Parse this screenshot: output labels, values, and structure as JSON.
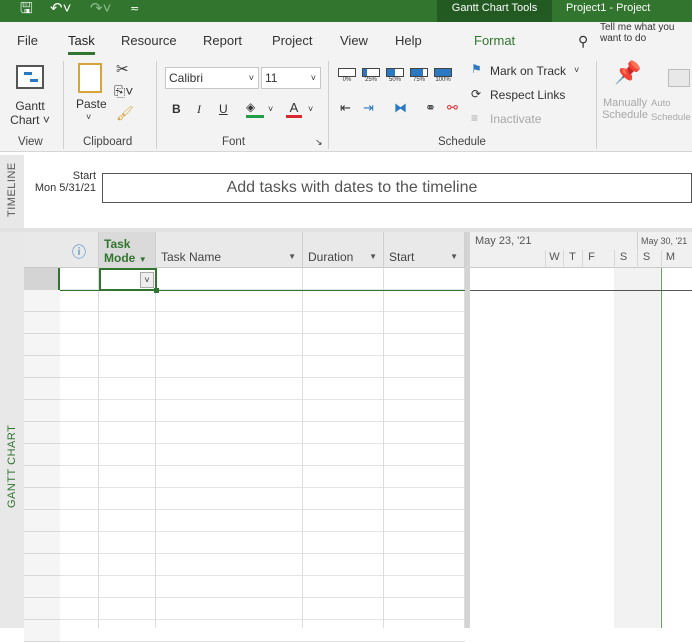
{
  "titlebar": {
    "context_tab": "Gantt Chart Tools",
    "title": "Project1  -  Project"
  },
  "tabs": [
    "File",
    "Task",
    "Resource",
    "Report",
    "Project",
    "View",
    "Help",
    "Format"
  ],
  "tell_me": "Tell me what you want to do",
  "ribbon": {
    "view": {
      "gantt_label": "Gantt",
      "chart_label": "Chart",
      "group": "View"
    },
    "clipboard": {
      "paste": "Paste",
      "group": "Clipboard"
    },
    "font": {
      "name": "Calibri",
      "size": "11",
      "bold": "B",
      "italic": "I",
      "underline": "U",
      "color_a": "A",
      "group": "Font"
    },
    "schedule": {
      "pct": [
        "0%",
        "25%",
        "50%",
        "75%",
        "100%"
      ],
      "mark_on_track": "Mark on Track",
      "respect_links": "Respect Links",
      "inactivate": "Inactivate",
      "group": "Schedule"
    },
    "tasks": {
      "manually": "Manually",
      "schedule": "Schedule",
      "auto": "Auto",
      "auto_schedule": "Schedule"
    },
    "colors": {
      "green": "#31752f",
      "highlight": "#1e9e47",
      "font_red": "#d9262f"
    }
  },
  "timeline": {
    "side": "TIMELINE",
    "start_label": "Start",
    "start_date": "Mon 5/31/21",
    "placeholder": "Add tasks with dates to the timeline"
  },
  "grid": {
    "side": "GANTT CHART",
    "columns": {
      "task_mode_1": "Task",
      "task_mode_2": "Mode",
      "task_name": "Task Name",
      "duration": "Duration",
      "start": "Start"
    }
  },
  "gantt": {
    "week1": "May 23, '21",
    "week2": "May 30, '21",
    "days": [
      "W",
      "T",
      "F",
      "S",
      "S",
      "M"
    ]
  }
}
